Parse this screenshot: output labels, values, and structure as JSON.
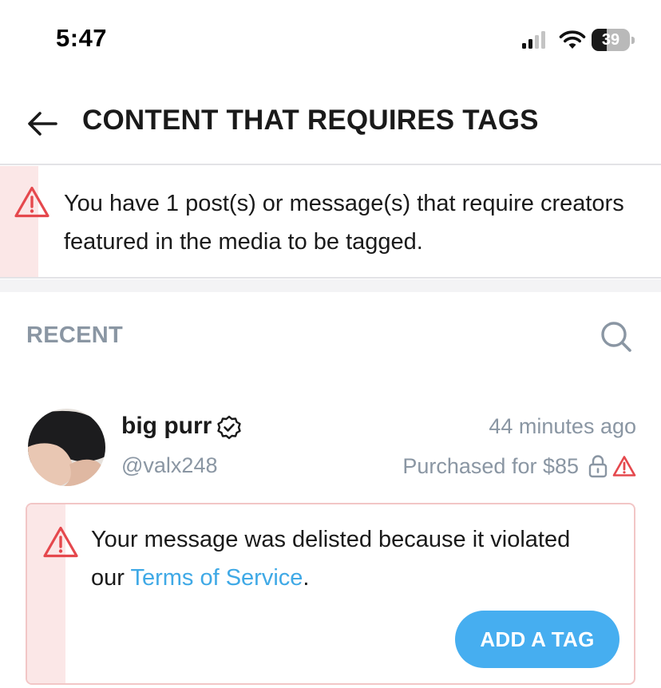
{
  "status_bar": {
    "time": "5:47",
    "battery_level": "39",
    "battery_fraction": 0.39
  },
  "header": {
    "back_icon": "arrow-left-icon",
    "title": "CONTENT THAT REQUIRES TAGS"
  },
  "banner": {
    "icon": "warning-triangle-icon",
    "message": "You have 1 post(s) or message(s) that require creators featured in the media to be tagged."
  },
  "recent": {
    "label": "RECENT",
    "search_icon": "search-icon"
  },
  "message": {
    "user_name": "big purr",
    "verified_icon": "verified-badge-icon",
    "handle": "@valx248",
    "time_ago": "44 minutes ago",
    "purchase_text": "Purchased for $85",
    "lock_icon": "lock-icon",
    "warning_icon": "warning-triangle-icon"
  },
  "delisted_card": {
    "icon": "warning-triangle-icon",
    "text_before": "Your message was delisted because it violated our ",
    "link_text": "Terms of Service",
    "text_after": ".",
    "button_label": "ADD A TAG"
  },
  "colors": {
    "accent_blue": "#46aef0",
    "link_blue": "#3fa9e6",
    "warning_red": "#e5484d",
    "alert_tint": "#fbe7e7",
    "muted_text": "#8a96a3"
  }
}
